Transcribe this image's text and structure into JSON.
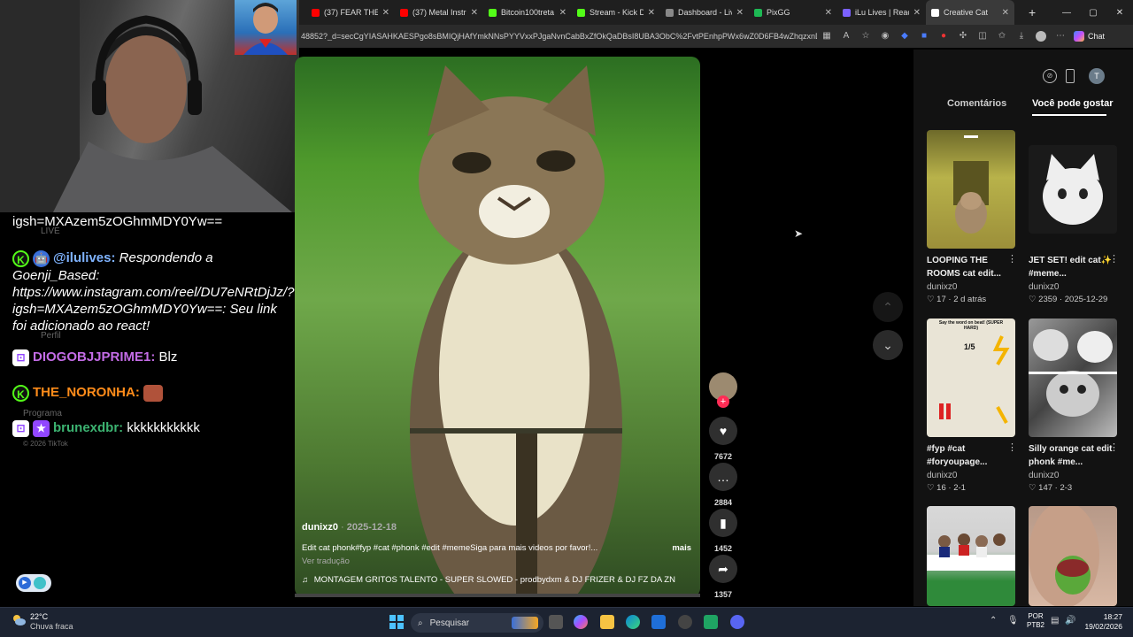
{
  "browser": {
    "tabs": [
      {
        "title": "(37) FEAR THE",
        "color": "#ff0000"
      },
      {
        "title": "(37) Metal Instrum",
        "color": "#ff0000"
      },
      {
        "title": "Bitcoin100treta S",
        "color": "#53fc18"
      },
      {
        "title": "Stream - Kick Da",
        "color": "#53fc18"
      },
      {
        "title": "Dashboard - Live",
        "color": "#888888"
      },
      {
        "title": "PixGG",
        "color": "#1db954"
      },
      {
        "title": "iLu Lives | React",
        "color": "#7b61ff"
      },
      {
        "title": "Creative Cat",
        "color": "#ffffff"
      }
    ],
    "url": "48852?_d=secCgYIASAHKAESPgo8sBMIQjHAfYmkNNsPYYVxxPJgaNvnCabBxZfOkQaDBsI8UBA3ObC%2FvtPEnhpPWx6wZ0D6FB4wZhqzxnD8...",
    "chat_label": "Chat"
  },
  "chat": {
    "lines": [
      {
        "pre": "",
        "user": "",
        "text": "igsh=MXAzem5zOGhmMDY0Yw=="
      },
      {
        "pre": "",
        "user": "@ilulives:",
        "text": "Respondendo a Goenji_Based: https://www.instagram.com/reel/DU7eNRtDjJz/?igsh=MXAzem5zOGhmMDY0Yw==: Seu link foi adicionado ao react!"
      },
      {
        "pre": "",
        "user": "DIOGOBJJPRIME1:",
        "text": "Blz"
      },
      {
        "pre": "",
        "user": "THE_NORONHA:",
        "text": ""
      },
      {
        "pre": "",
        "user": "brunexdbr:",
        "text": "kkkkkkkkkkk"
      }
    ],
    "ghost": [
      "LIVE",
      "Perfil",
      "Programa",
      "© 2026 TikTok"
    ]
  },
  "video": {
    "author": "dunixz0",
    "date": "2025-12-18",
    "caption": "Edit cat phonk#fyp #cat #phonk #edit #memeSiga para mais videos por favor!...",
    "more": "mais",
    "translate": "Ver tradução",
    "music": "MONTAGEM GRITOS TALENTO - SUPER SLOWED - prodbydxm & DJ FRIZER & DJ FZ DA ZN",
    "progress": 0.0
  },
  "actions": {
    "likes": "7672",
    "comments": "2884",
    "saves": "1452",
    "shares": "1357"
  },
  "panel": {
    "tabs": [
      "Comentários",
      "Você pode gostar"
    ],
    "avatar_letter": "T",
    "cards": [
      {
        "title": "LOOPING THE ROOMS cat edit...",
        "user": "dunixz0",
        "likes": "17",
        "date": "2 d atrás"
      },
      {
        "title": "JET SET! edit cat✨ #meme...",
        "user": "dunixz0",
        "likes": "2359",
        "date": "2025-12-29"
      },
      {
        "title": "#fyp #cat #foryoupage...",
        "user": "dunixz0",
        "likes": "16",
        "date": "2-1"
      },
      {
        "title": "Silly orange cat edit phonk #me...",
        "user": "dunixz0",
        "likes": "147",
        "date": "2-3"
      }
    ],
    "thumb2_text": "Say the word on beat! (SUPER HARD)",
    "thumb2_counter": "1/5"
  },
  "taskbar": {
    "weather_temp": "22°C",
    "weather_desc": "Chuva fraca",
    "search": "Pesquisar",
    "lang": "POR",
    "lang2": "PTB2",
    "time": "18:27",
    "date": "19/02/2026"
  }
}
